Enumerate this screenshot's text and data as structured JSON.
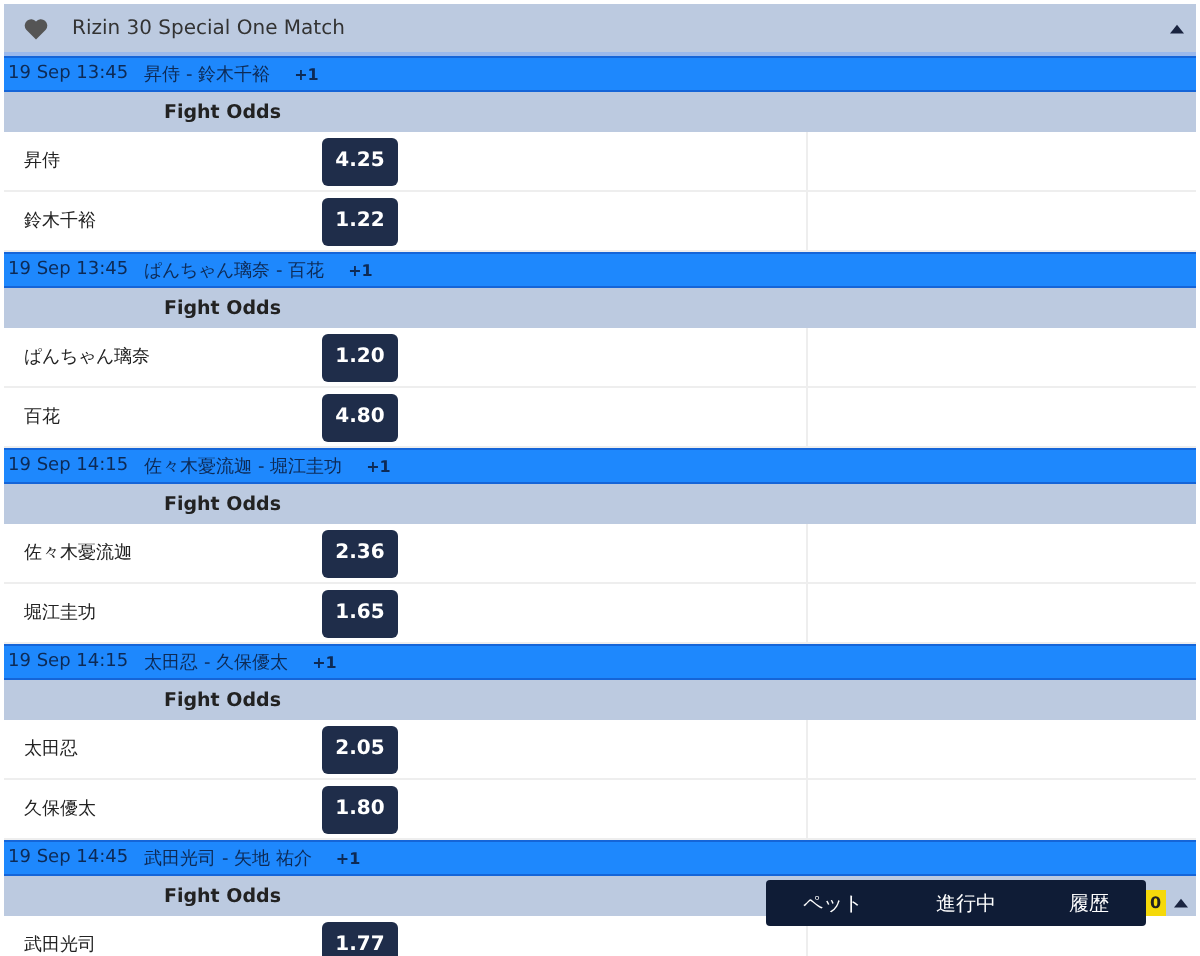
{
  "header": {
    "title": "Rizin 30 Special One Match",
    "expanded": true
  },
  "matches": [
    {
      "time": "19 Sep 13:45",
      "title": "昇侍 - 鈴木千裕",
      "more": "+1",
      "market": "Fight Odds",
      "runners": [
        {
          "name": "昇侍",
          "odds": "4.25"
        },
        {
          "name": "鈴木千裕",
          "odds": "1.22"
        }
      ]
    },
    {
      "time": "19 Sep 13:45",
      "title": "ぱんちゃん璃奈 - 百花",
      "more": "+1",
      "market": "Fight Odds",
      "runners": [
        {
          "name": "ぱんちゃん璃奈",
          "odds": "1.20"
        },
        {
          "name": "百花",
          "odds": "4.80"
        }
      ]
    },
    {
      "time": "19 Sep 14:15",
      "title": "佐々木憂流迦 - 堀江圭功",
      "more": "+1",
      "market": "Fight Odds",
      "runners": [
        {
          "name": "佐々木憂流迦",
          "odds": "2.36"
        },
        {
          "name": "堀江圭功",
          "odds": "1.65"
        }
      ]
    },
    {
      "time": "19 Sep 14:15",
      "title": "太田忍 - 久保優太",
      "more": "+1",
      "market": "Fight Odds",
      "runners": [
        {
          "name": "太田忍",
          "odds": "2.05"
        },
        {
          "name": "久保優太",
          "odds": "1.80"
        }
      ]
    },
    {
      "time": "19 Sep 14:45",
      "title": "武田光司 - 矢地 祐介",
      "more": "+1",
      "market": "Fight Odds",
      "runners": [
        {
          "name": "武田光司",
          "odds": "1.77"
        }
      ]
    }
  ],
  "betslip": {
    "tabs": [
      {
        "label": "ペット"
      },
      {
        "label": "進行中"
      },
      {
        "label": "履歴"
      }
    ],
    "count": "0"
  }
}
